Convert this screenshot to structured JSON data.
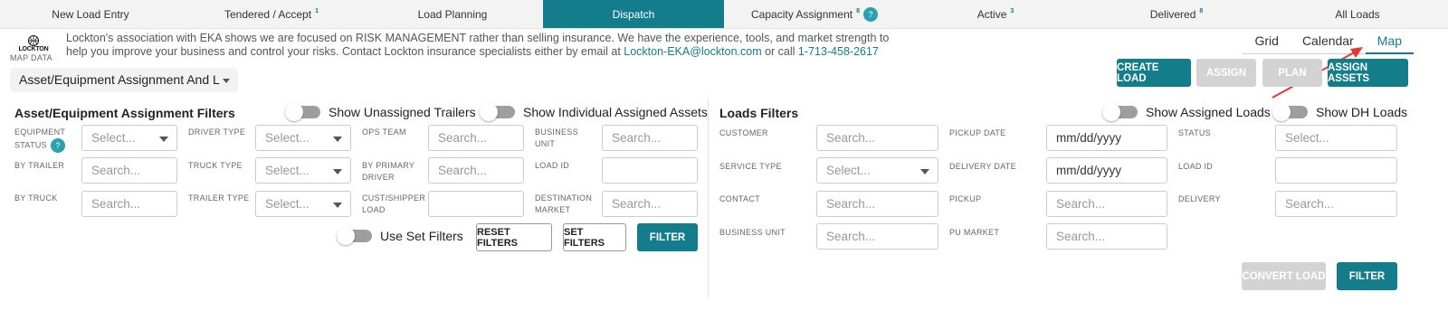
{
  "nav": {
    "tabs": [
      {
        "label": "New Load Entry",
        "count": ""
      },
      {
        "label": "Tendered / Accept",
        "count": "1"
      },
      {
        "label": "Load Planning",
        "count": ""
      },
      {
        "label": "Dispatch",
        "count": ""
      },
      {
        "label": "Capacity Assignment",
        "count": "8",
        "help": "?"
      },
      {
        "label": "Active",
        "count": "3"
      },
      {
        "label": "Delivered",
        "count": "8"
      },
      {
        "label": "All Loads",
        "count": ""
      }
    ],
    "active_tab": "Dispatch"
  },
  "branding": {
    "logo_text": "LOCKTON",
    "map_data": "MAP DATA"
  },
  "banner": {
    "text": "Lockton's association with EKA shows we are focused on RISK MANAGEMENT rather than selling insurance. We have the experience, tools, and market strength to help you improve your business and control your risks. Contact Lockton insurance specialists either by email at ",
    "email": "Lockton-EKA@lockton.com",
    "middle": " or call ",
    "phone": "1-713-458-2617"
  },
  "view_tabs": [
    "Grid",
    "Calendar",
    "Map"
  ],
  "active_view": "Map",
  "view_select": {
    "value": "Asset/Equipment Assignment And L"
  },
  "actions": {
    "create_load": "CREATE LOAD",
    "assign": "ASSIGN",
    "plan": "PLAN",
    "assign_assets": "ASSIGN ASSETS"
  },
  "asset_filters": {
    "title": "Asset/Equipment Assignment Filters",
    "toggle_unassigned": "Show Unassigned Trailers",
    "toggle_individual": "Show Individual Assigned Assets",
    "labels": {
      "equipment_status_1": "EQUIPMENT",
      "equipment_status_2": "STATUS",
      "driver_type": "DRIVER TYPE",
      "ops_team": "OPS TEAM",
      "business_unit_1": "BUSINESS",
      "business_unit_2": "UNIT",
      "by_trailer": "BY TRAILER",
      "truck_type": "TRUCK TYPE",
      "by_primary_1": "BY PRIMARY",
      "by_primary_2": "DRIVER",
      "load_id": "LOAD ID",
      "by_truck": "BY TRUCK",
      "trailer_type": "TRAILER TYPE",
      "cust_shipper_1": "CUST/SHIPPER",
      "cust_shipper_2": "LOAD",
      "destination_1": "DESTINATION",
      "destination_2": "MARKET"
    },
    "help": "?",
    "select_placeholder": "Select...",
    "search_placeholder": "Search...",
    "use_set_filters": "Use Set Filters",
    "reset_filters": "RESET FILTERS",
    "set_filters": "SET FILTERS",
    "filter": "FILTER"
  },
  "loads_filters": {
    "title": "Loads Filters",
    "toggle_assigned": "Show Assigned Loads",
    "toggle_dh": "Show DH Loads",
    "labels": {
      "customer": "CUSTOMER",
      "pickup_date": "PICKUP DATE",
      "status": "STATUS",
      "service_type": "SERVICE TYPE",
      "delivery_date": "DELIVERY DATE",
      "load_id": "LOAD ID",
      "contact": "CONTACT",
      "pickup": "PICKUP",
      "delivery": "DELIVERY",
      "business_unit": "BUSINESS UNIT",
      "pu_market": "PU MARKET"
    },
    "date_placeholder": "mm/dd/yyyy",
    "select_placeholder": "Select...",
    "search_placeholder": "Search...",
    "convert_load": "CONVERT LOAD",
    "filter": "FILTER"
  },
  "colors": {
    "accent": "#137d8b",
    "disabled": "#d3d3d3",
    "arrow": "#e53935"
  }
}
